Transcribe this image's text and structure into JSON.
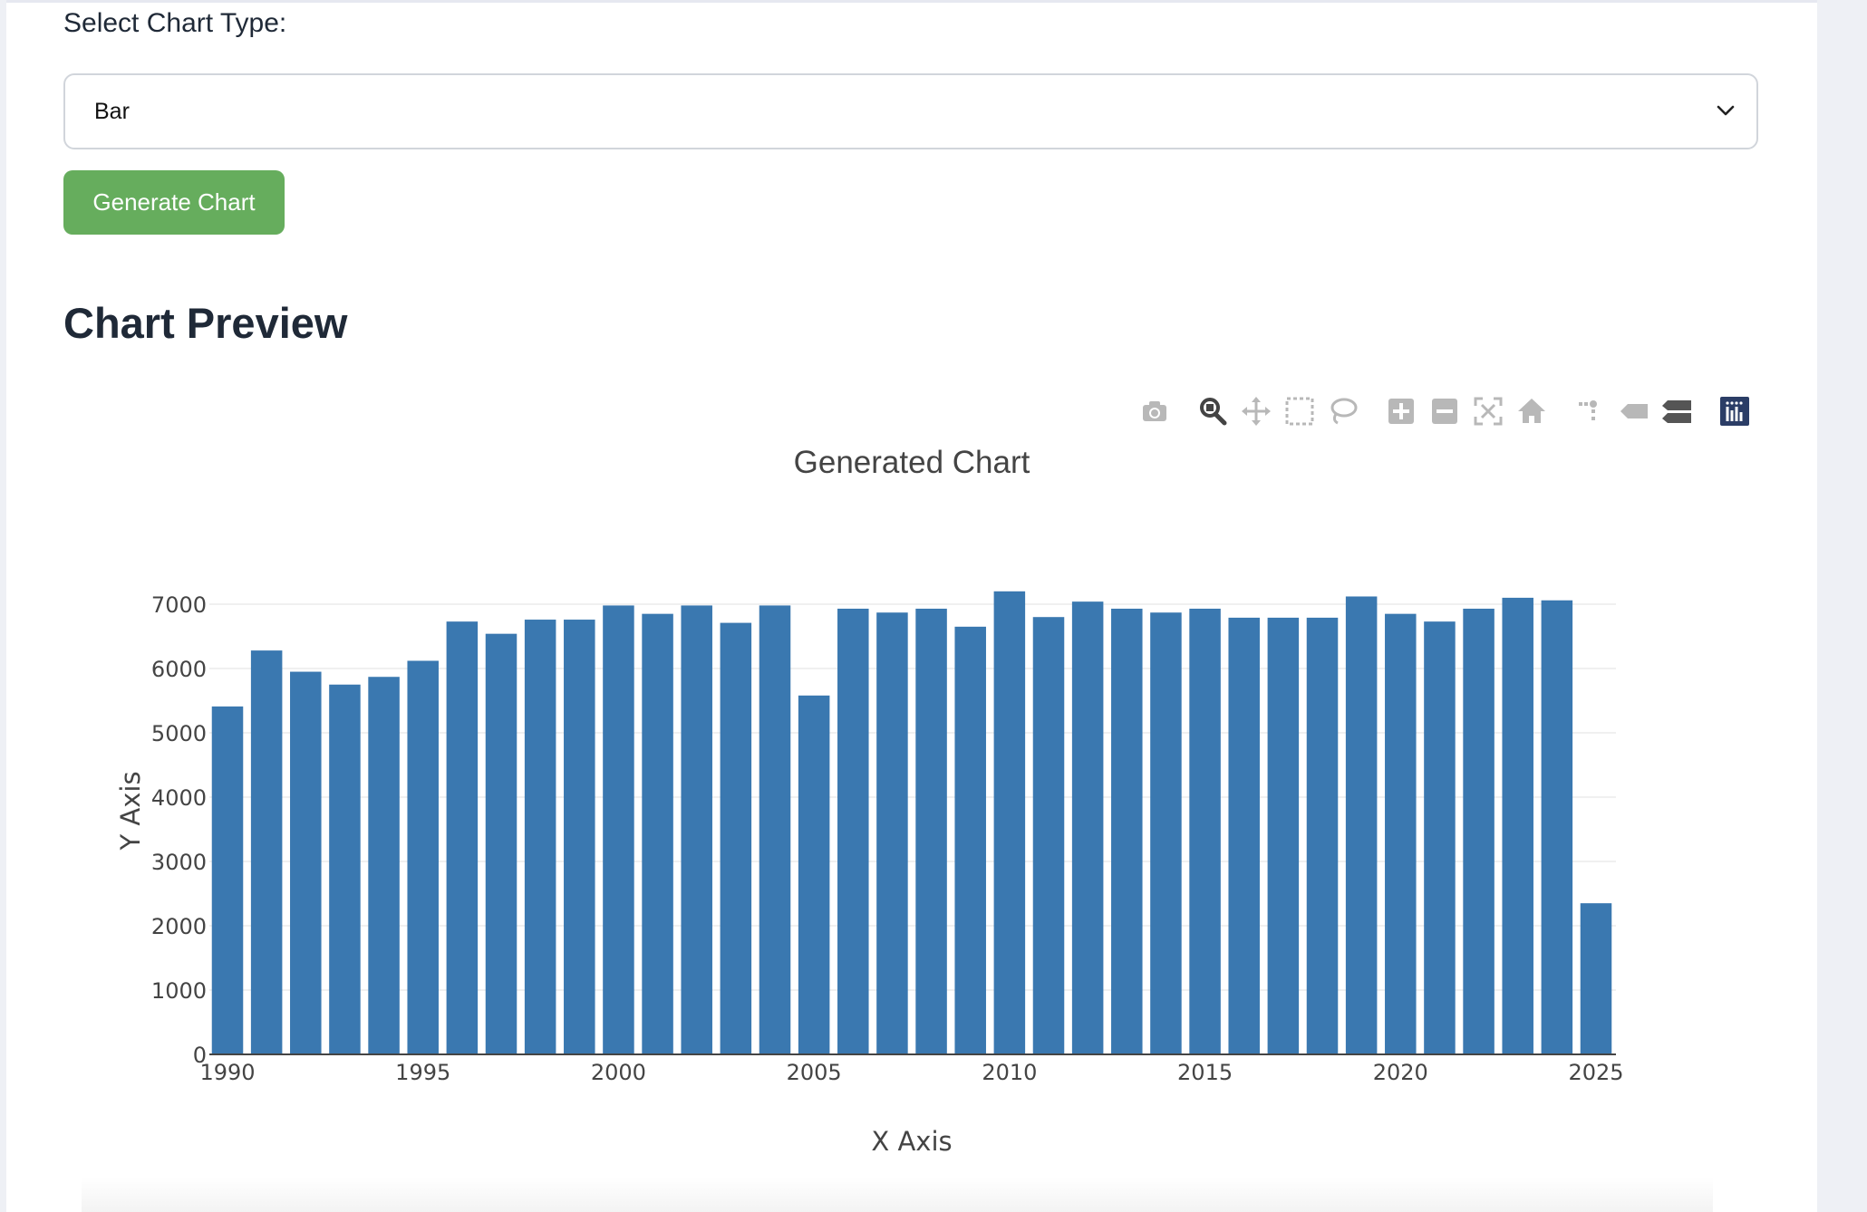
{
  "form": {
    "select_label": "Select Chart Type:",
    "selected_option": "Bar",
    "generate_label": "Generate Chart"
  },
  "preview": {
    "heading": "Chart Preview"
  },
  "modebar": {
    "icons": [
      "camera-icon",
      "zoom-icon",
      "pan-icon",
      "box-select-icon",
      "lasso-select-icon",
      "zoom-in-icon",
      "zoom-out-icon",
      "autoscale-icon",
      "reset-axes-icon",
      "spike-lines-icon",
      "hover-closest-icon",
      "hover-compare-icon",
      "plotly-logo-icon"
    ]
  },
  "colors": {
    "bar": "#3a78b0",
    "button": "#66ad5d",
    "heading": "#1f2937"
  },
  "chart_data": {
    "type": "bar",
    "title": "Generated Chart",
    "xlabel": "X Axis",
    "ylabel": "Y Axis",
    "x": [
      1990,
      1991,
      1992,
      1993,
      1994,
      1995,
      1996,
      1997,
      1998,
      1999,
      2000,
      2001,
      2002,
      2003,
      2004,
      2005,
      2006,
      2007,
      2008,
      2009,
      2010,
      2011,
      2012,
      2013,
      2014,
      2015,
      2016,
      2017,
      2018,
      2019,
      2020,
      2021,
      2022,
      2023,
      2024,
      2025
    ],
    "values": [
      5410,
      6280,
      5950,
      5750,
      5870,
      6120,
      6730,
      6540,
      6760,
      6760,
      6980,
      6850,
      6980,
      6710,
      6980,
      5580,
      6930,
      6870,
      6930,
      6650,
      7200,
      6800,
      7040,
      6930,
      6870,
      6930,
      6790,
      6790,
      6790,
      7120,
      6850,
      6730,
      6930,
      7100,
      7060,
      2350
    ],
    "ylim": [
      0,
      7000
    ],
    "yticks": [
      0,
      1000,
      2000,
      3000,
      4000,
      5000,
      6000,
      7000
    ],
    "xticks": [
      1990,
      1995,
      2000,
      2005,
      2010,
      2015,
      2020,
      2025
    ],
    "grid": true
  }
}
